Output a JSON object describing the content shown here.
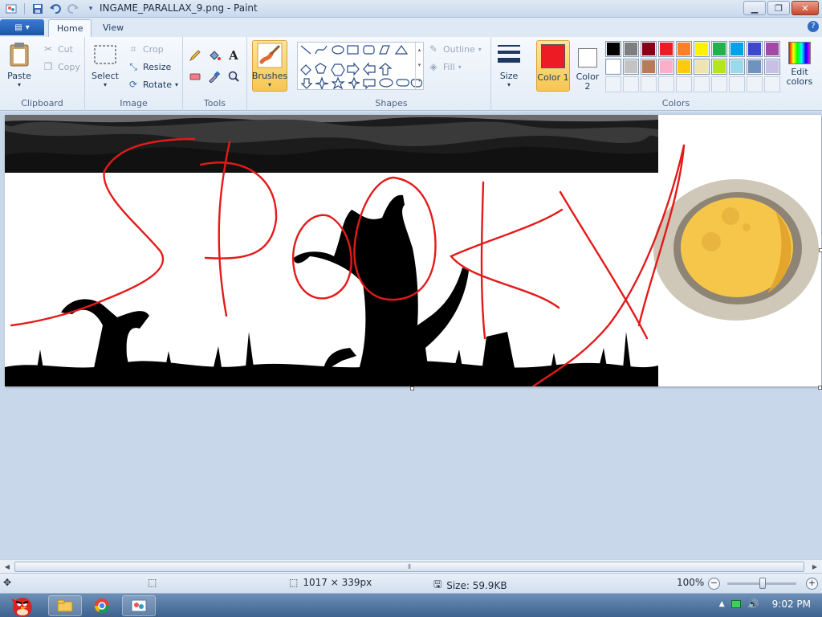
{
  "window": {
    "title": "INGAME_PARALLAX_9.png - Paint"
  },
  "tabs": [
    {
      "label": "Home",
      "active": true
    },
    {
      "label": "View",
      "active": false
    }
  ],
  "ribbon": {
    "clipboard": {
      "label": "Clipboard",
      "paste": "Paste",
      "cut": "Cut",
      "copy": "Copy"
    },
    "image": {
      "label": "Image",
      "select": "Select",
      "crop": "Crop",
      "resize": "Resize",
      "rotate": "Rotate"
    },
    "tools": {
      "label": "Tools"
    },
    "brushes": "Brushes",
    "shapes": {
      "label": "Shapes",
      "outline": "Outline",
      "fill": "Fill"
    },
    "size": "Size",
    "color1": "Color 1",
    "color2": "Color 2",
    "colors": {
      "label": "Colors",
      "edit": "Edit colors",
      "color1_value": "#ed1c24",
      "color2_value": "#ffffff",
      "palette_row1": [
        "#000000",
        "#7f7f7f",
        "#880015",
        "#ed1c24",
        "#ff7f27",
        "#fff200",
        "#22b14c",
        "#00a2e8",
        "#3f48cc",
        "#a349a4"
      ],
      "palette_row2": [
        "#ffffff",
        "#c3c3c3",
        "#b97a57",
        "#ffaec9",
        "#ffc90e",
        "#efe4b0",
        "#b5e61d",
        "#99d9ea",
        "#7092be",
        "#c8bfe7"
      ]
    }
  },
  "status": {
    "dimensions": "1017 × 339px",
    "size": "Size: 59.9KB",
    "zoom": "100%"
  },
  "taskbar": {
    "time": "9:02 PM"
  }
}
